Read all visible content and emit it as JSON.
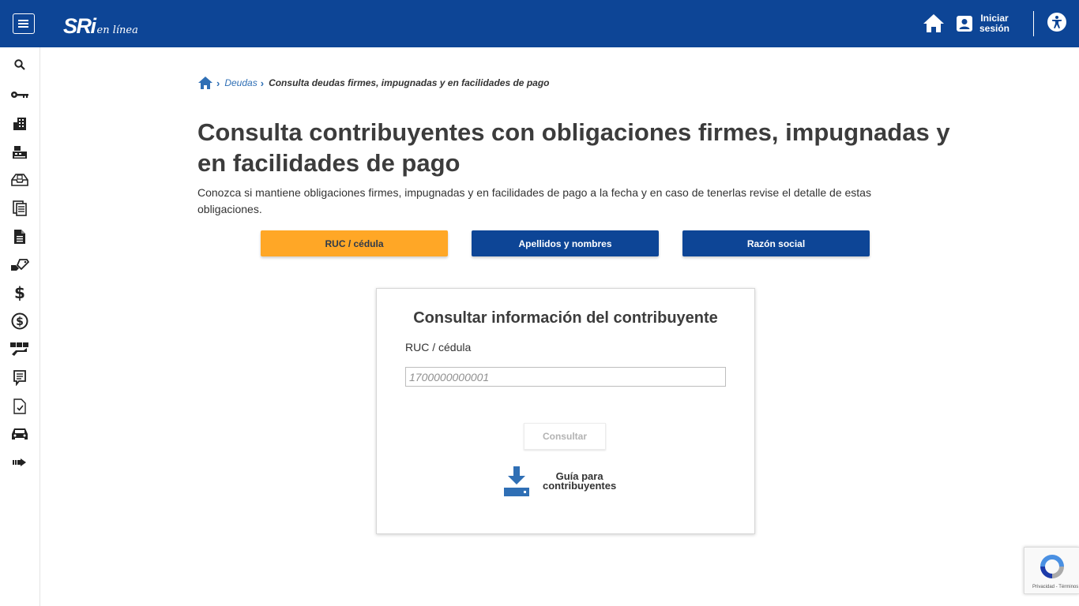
{
  "header": {
    "logo_text": "SRi",
    "logo_subtext": "en línea",
    "login_line1": "Iniciar",
    "login_line2": "sesión"
  },
  "sidebar": {
    "items": [
      {
        "icon": "search-icon"
      },
      {
        "icon": "key-icon"
      },
      {
        "icon": "buildings-icon"
      },
      {
        "icon": "cash-register-icon"
      },
      {
        "icon": "inbox-tray-icon"
      },
      {
        "icon": "documents-icon"
      },
      {
        "icon": "file-text-icon"
      },
      {
        "icon": "hand-tag-icon"
      },
      {
        "icon": "dollar-icon"
      },
      {
        "icon": "dollar-circle-icon"
      },
      {
        "icon": "exchange-icon"
      },
      {
        "icon": "notes-icon"
      },
      {
        "icon": "checked-document-icon"
      },
      {
        "icon": "car-icon"
      },
      {
        "icon": "arrow-right-icon"
      }
    ]
  },
  "breadcrumb": {
    "link": "Deudas",
    "current": "Consulta deudas firmes, impugnadas y en facilidades de pago"
  },
  "page": {
    "title": "Consulta contribuyentes con obligaciones firmes, impugnadas y en facilidades de pago",
    "description": "Conozca si mantiene obligaciones firmes, impugnadas y en facilidades de pago a la fecha y en caso de tenerlas revise el detalle de estas obligaciones."
  },
  "tabs": [
    {
      "label": "RUC / cédula",
      "active": true
    },
    {
      "label": "Apellidos y nombres",
      "active": false
    },
    {
      "label": "Razón social",
      "active": false
    }
  ],
  "form": {
    "title": "Consultar información del contribuyente",
    "field_label": "RUC / cédula",
    "field_placeholder": "1700000000001",
    "field_value": "",
    "submit_label": "Consultar",
    "guide_line1": "Guía para",
    "guide_line2": "contribuyentes"
  },
  "recaptcha": {
    "text": "Privacidad - Términos"
  },
  "colors": {
    "brand_blue": "#0d4596",
    "accent_orange": "#ffa726",
    "link_blue": "#2f6fb5"
  }
}
